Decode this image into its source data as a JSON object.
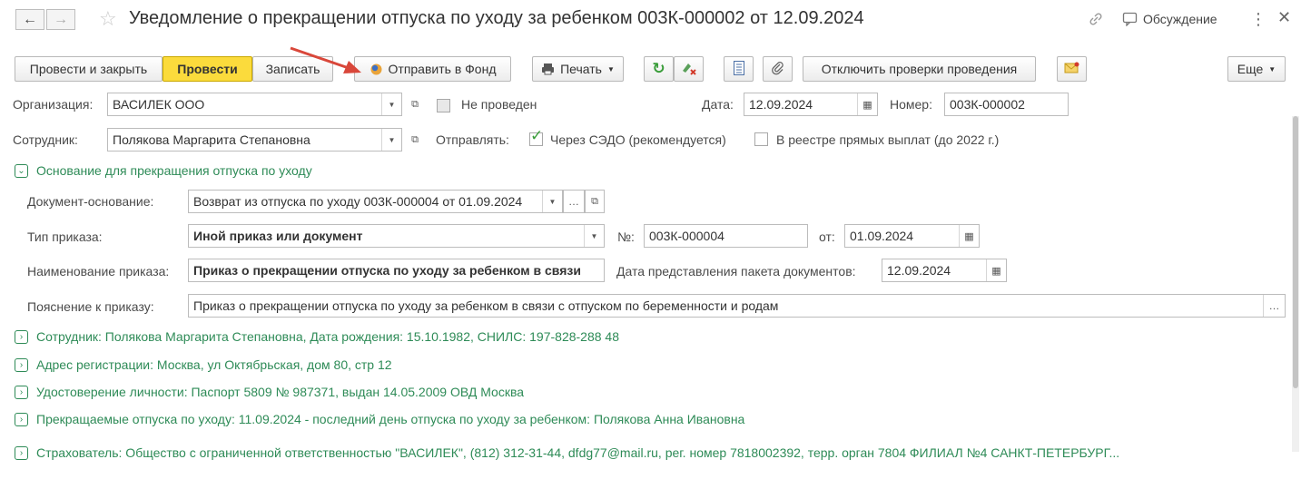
{
  "window": {
    "title": "Уведомление о прекращении отпуска по уходу за ребенком 003К-000002 от 12.09.2024",
    "discussion_label": "Обсуждение",
    "back_icon": "arrow-left-icon",
    "forward_icon": "arrow-right-icon"
  },
  "toolbar": {
    "post_close": "Провести и закрыть",
    "post": "Провести",
    "save": "Записать",
    "send_fund": "Отправить в Фонд",
    "print": "Печать",
    "disable_checks": "Отключить проверки проведения",
    "more": "Еще"
  },
  "form": {
    "org_label": "Организация:",
    "org_value": "ВАСИЛЕК ООО",
    "not_posted_label": "Не проведен",
    "date_label": "Дата:",
    "date_value": "12.09.2024",
    "number_label": "Номер:",
    "number_value": "003К-000002",
    "employee_label": "Сотрудник:",
    "employee_value": "Полякова Маргарита Степановна",
    "send_label": "Отправлять:",
    "send_sedo": "Через СЭДО (рекомендуется)",
    "send_registry": "В реестре прямых выплат (до 2022 г.)"
  },
  "basis": {
    "group_title": "Основание для прекращения отпуска по уходу",
    "doc_label": "Документ-основание:",
    "doc_value": "Возврат из отпуска по уходу 003К-000004 от 01.09.2024",
    "order_type_label": "Тип приказа:",
    "order_type_value": "Иной приказ или документ",
    "no_label": "№:",
    "no_value": "003К-000004",
    "from_label": "от:",
    "from_value": "01.09.2024",
    "order_name_label": "Наименование приказа:",
    "order_name_value": "Приказ о прекращении отпуска по уходу за ребенком в связи",
    "package_date_label": "Дата представления пакета документов:",
    "package_date_value": "12.09.2024",
    "note_label": "Пояснение к приказу:",
    "note_value": "Приказ о прекращении отпуска по уходу за ребенком в связи с отпуском по беременности и родам"
  },
  "groups": [
    "Сотрудник: Полякова Маргарита Степановна, Дата рождения: 15.10.1982, СНИЛС: 197-828-288 48",
    "Адрес регистрации: Москва, ул Октябрьская, дом 80, стр 12",
    "Удостоверение личности: Паспорт 5809 № 987371, выдан 14.05.2009 ОВД Москва",
    "Прекращаемые отпуска по уходу: 11.09.2024 - последний день отпуска по уходу за ребенком: Полякова Анна Ивановна",
    "Страхователь: Общество с ограниченной ответственностью \"ВАСИЛЕК\", (812) 312-31-44, dfdg77@mail.ru, рег. номер 7818002392, терр. орган 7804 ФИЛИАЛ №4 САНКТ-ПЕТЕРБУРГ..."
  ],
  "colors": {
    "accent_yellow": "#fbdb3c",
    "group_green": "#2e8b57",
    "annotation_red": "#d9473a"
  }
}
